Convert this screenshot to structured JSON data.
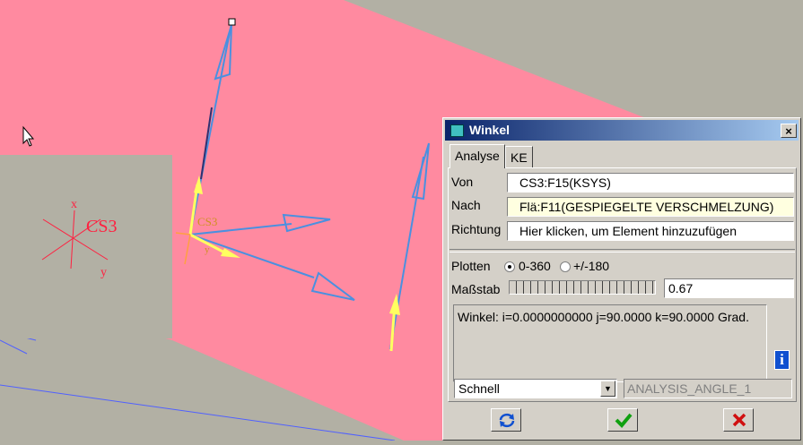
{
  "viewport": {
    "csys_label_model": "CS3",
    "csys_label_inset": "CS3",
    "axis_x": "x",
    "axis_y": "y",
    "axis_z": "z",
    "colors": {
      "surface": "#ff8aa0",
      "background": "#b2b0a4",
      "vector_blue": "#4a90e0",
      "vector_yellow": "#ffff60",
      "inset_red": "#ff2040"
    }
  },
  "dialog": {
    "title": "Winkel",
    "close_label": "×",
    "tabs": [
      {
        "label": "Analyse",
        "active": true
      },
      {
        "label": "KE",
        "active": false
      }
    ],
    "von_label": "Von",
    "von_value": "CS3:F15(KSYS)",
    "nach_label": "Nach",
    "nach_value": "Flä:F11(GESPIEGELTE VERSCHMELZUNG)",
    "richtung_label": "Richtung",
    "richtung_value": "Hier klicken, um Element hinzuzufügen",
    "plotten_label": "Plotten",
    "plot_options": [
      {
        "label": "0-360",
        "selected": true
      },
      {
        "label": "+/-180",
        "selected": false
      }
    ],
    "massstab_label": "Maßstab",
    "massstab_value": "0.67",
    "result_text": "Winkel: i=0.0000000000 j=90.0000 k=90.0000 Grad.",
    "mode_value": "Schnell",
    "analysis_name": "ANALYSIS_ANGLE_1",
    "icons": {
      "info": "info-icon",
      "repeat": "repeat-icon",
      "ok": "checkmark-icon",
      "cancel": "x-icon"
    }
  }
}
